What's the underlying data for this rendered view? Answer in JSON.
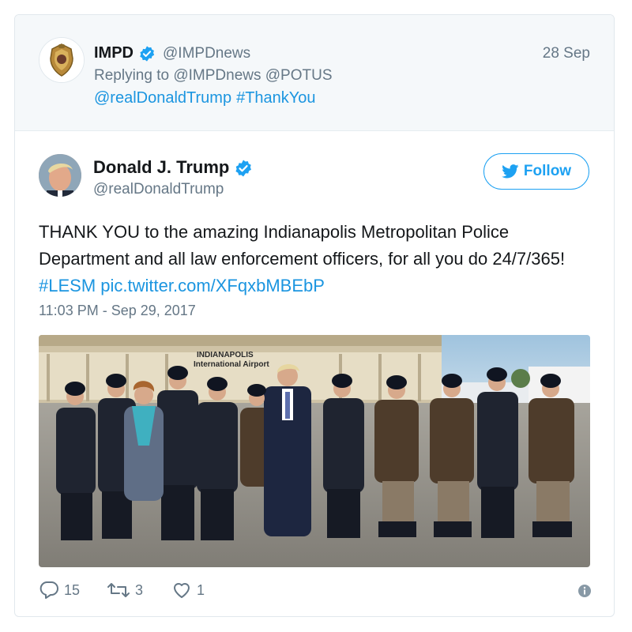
{
  "parent_tweet": {
    "name": "IMPD",
    "handle": "@IMPDnews",
    "date": "28 Sep",
    "replying_to": "Replying to @IMPDnews @POTUS",
    "text_parts": [
      "@realDonaldTrump",
      "#ThankYou"
    ]
  },
  "main_tweet": {
    "name": "Donald J. Trump",
    "handle": "@realDonaldTrump",
    "follow_label": "Follow",
    "text_plain": "THANK YOU to the amazing Indianapolis Metropolitan Police Department and all law enforcement officers, for all you do 24/7/365!",
    "hashtag": "#LESM",
    "link": "pic.twitter.com/XFqxbMBEbP",
    "timestamp": "11:03 PM - Sep 29, 2017",
    "photo_sign": "INDIANAPOLIS International Airport"
  },
  "actions": {
    "reply_count": "15",
    "retweet_count": "3",
    "like_count": "1"
  },
  "colors": {
    "accent": "#1da1f2",
    "link": "#1b95e0",
    "secondary_text": "#657786",
    "parent_bg": "#f5f8fa"
  },
  "icons": [
    "badge-logo",
    "verified-icon",
    "bird-icon",
    "reply-icon",
    "retweet-icon",
    "like-icon",
    "info-icon"
  ]
}
